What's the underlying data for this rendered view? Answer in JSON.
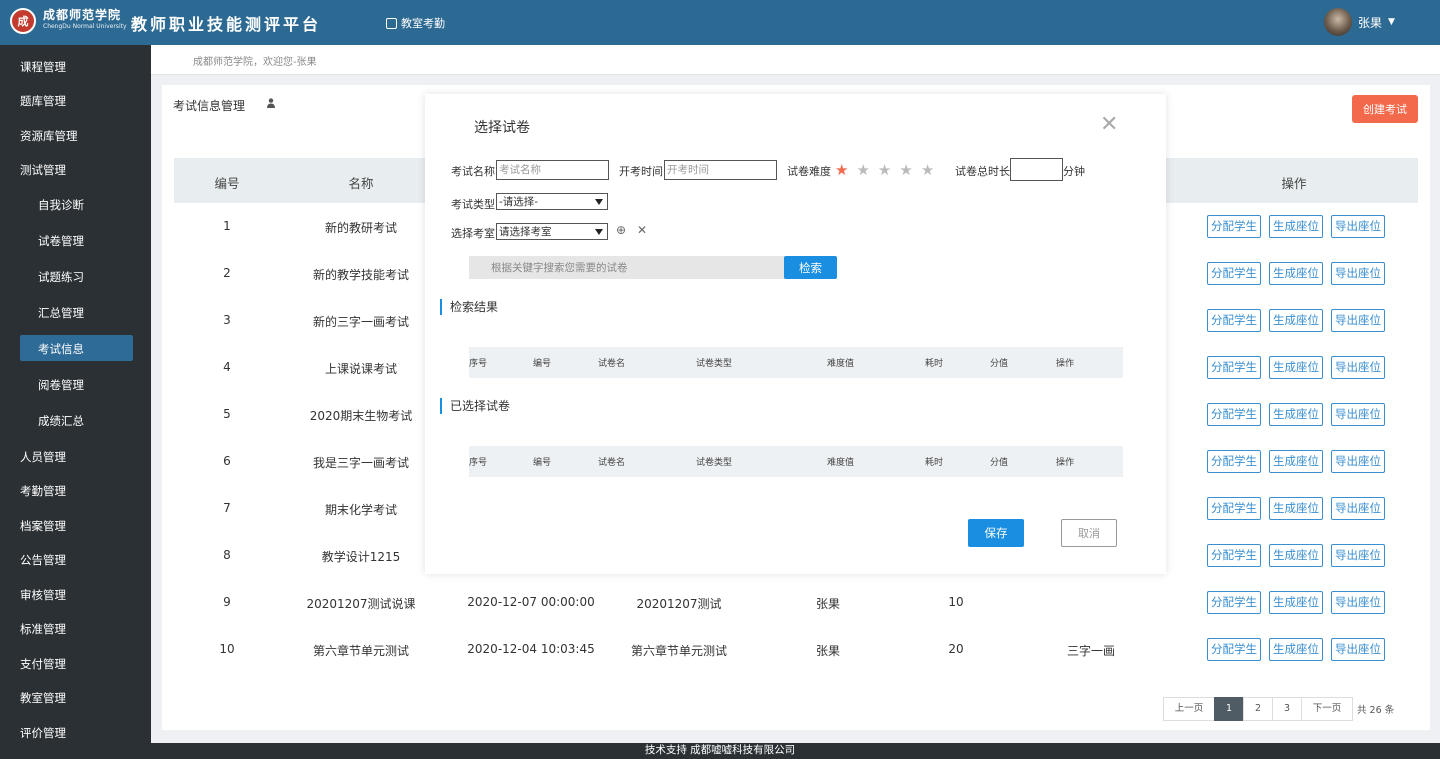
{
  "header": {
    "logo_glyph": "成",
    "school_name_cn": "成都师范学院",
    "school_name_en": "ChengDu Normal University",
    "platform_title": "教师职业技能测评平台",
    "nav_attendance": "教室考勤",
    "user_name": "张果"
  },
  "sidebar": {
    "items": [
      "课程管理",
      "题库管理",
      "资源库管理",
      "测试管理"
    ],
    "sub_items": [
      "自我诊断",
      "试卷管理",
      "试题练习",
      "汇总管理",
      "考试信息",
      "阅卷管理",
      "成绩汇总"
    ],
    "items_after": [
      "人员管理",
      "考勤管理",
      "档案管理",
      "公告管理",
      "审核管理",
      "标准管理",
      "支付管理",
      "教室管理",
      "评价管理"
    ]
  },
  "breadcrumb": "成都师范学院，欢迎您-张果",
  "page": {
    "title": "考试信息管理",
    "create_button": "创建考试"
  },
  "table": {
    "headers": [
      "编号",
      "名称",
      "操作"
    ],
    "rows": [
      {
        "id": "1",
        "name": "新的教研考试",
        "time": "",
        "paper": "",
        "creator": "",
        "duration": "",
        "room": ""
      },
      {
        "id": "2",
        "name": "新的教学技能考试",
        "time": "",
        "paper": "",
        "creator": "",
        "duration": "",
        "room": ""
      },
      {
        "id": "3",
        "name": "新的三字一画考试",
        "time": "",
        "paper": "",
        "creator": "",
        "duration": "",
        "room": ""
      },
      {
        "id": "4",
        "name": "上课说课考试",
        "time": "",
        "paper": "",
        "creator": "",
        "duration": "",
        "room": ""
      },
      {
        "id": "5",
        "name": "2020期末生物考试",
        "time": "",
        "paper": "",
        "creator": "",
        "duration": "",
        "room": ""
      },
      {
        "id": "6",
        "name": "我是三字一画考试",
        "time": "",
        "paper": "",
        "creator": "",
        "duration": "",
        "room": ""
      },
      {
        "id": "7",
        "name": "期末化学考试",
        "time": "",
        "paper": "",
        "creator": "",
        "duration": "",
        "room": ""
      },
      {
        "id": "8",
        "name": "教学设计1215",
        "time": "",
        "paper": "",
        "creator": "",
        "duration": "",
        "room": ""
      },
      {
        "id": "9",
        "name": "20201207测试说课",
        "time": "2020-12-07 00:00:00",
        "paper": "20201207测试",
        "creator": "张果",
        "duration": "10",
        "room": ""
      },
      {
        "id": "10",
        "name": "第六章节单元测试",
        "time": "2020-12-04 10:03:45",
        "paper": "第六章节单元测试",
        "creator": "张果",
        "duration": "20",
        "room": "三字一画"
      }
    ],
    "action_labels": [
      "分配学生",
      "生成座位",
      "导出座位"
    ]
  },
  "pagination": {
    "prev": "上一页",
    "pages": [
      "1",
      "2",
      "3"
    ],
    "current": "1",
    "next": "下一页",
    "total": "共 26 条"
  },
  "footer": "技术支持 成都嘘嘘科技有限公司",
  "modal": {
    "title": "选择试卷",
    "exam_name_label": "考试名称",
    "exam_name_placeholder": "考试名称",
    "start_time_label": "开考时间",
    "start_time_placeholder": "开考时间",
    "difficulty_label": "试卷难度",
    "difficulty_stars": 1,
    "difficulty_max": 5,
    "duration_label": "试卷总时长",
    "duration_unit": "分钟",
    "exam_type_label": "考试类型",
    "exam_type_value": "-请选择-",
    "room_label": "选择考室",
    "room_value": "请选择考室",
    "search_placeholder": "根据关键字搜索您需要的试卷",
    "search_button": "检索",
    "results_title": "检索结果",
    "selected_title": "已选择试卷",
    "columns": [
      "序号",
      "编号",
      "试卷名",
      "试卷类型",
      "难度值",
      "耗时",
      "分值",
      "操作"
    ],
    "save": "保存",
    "cancel": "取消"
  },
  "colors": {
    "header_bg": "#2d6a93",
    "sidebar_bg": "#2b3034",
    "sidebar_active": "#2f6b97",
    "accent_blue": "#1a8ee0",
    "create_orange": "#f2694b",
    "star_active": "#f2694b",
    "star_inactive": "#bbbbbb"
  }
}
